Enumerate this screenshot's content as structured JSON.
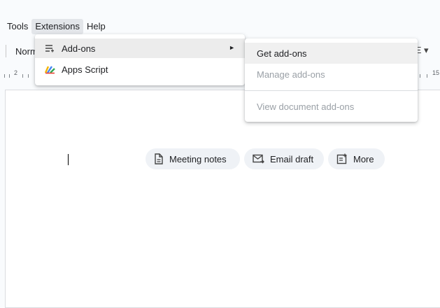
{
  "menubar": {
    "items": [
      "Tools",
      "Extensions",
      "Help"
    ]
  },
  "toolbar": {
    "style_label": "Norm",
    "right_fragment": "Ξ ▾"
  },
  "ruler": {
    "label_left": "2",
    "label_right": "15"
  },
  "extensions_menu": {
    "items": [
      {
        "label": "Add-ons",
        "icon": "addons-icon",
        "has_submenu": true
      },
      {
        "label": "Apps Script",
        "icon": "apps-script-icon"
      }
    ],
    "submenu_arrow": "►"
  },
  "addons_submenu": {
    "items": [
      {
        "label": "Get add-ons",
        "enabled": true
      },
      {
        "label": "Manage add-ons",
        "enabled": false
      },
      {
        "label": "View document add-ons",
        "enabled": false
      }
    ]
  },
  "chips": [
    {
      "label": "Meeting notes",
      "icon": "document-icon"
    },
    {
      "label": "Email draft",
      "icon": "email-icon"
    },
    {
      "label": "More",
      "icon": "more-doc-icon"
    }
  ]
}
